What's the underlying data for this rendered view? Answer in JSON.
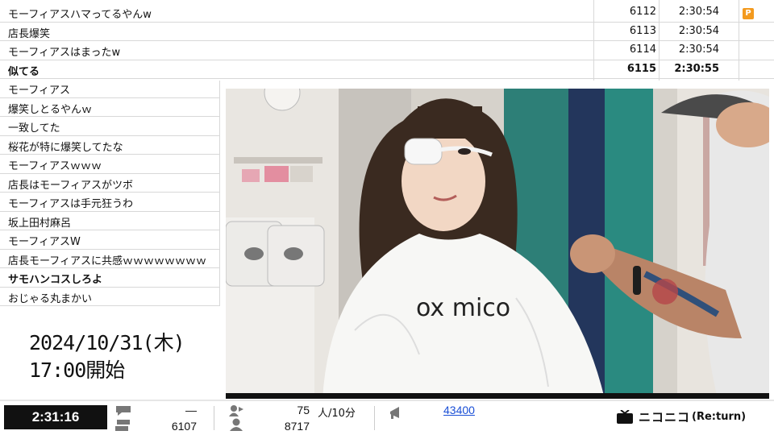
{
  "comments_top": [
    {
      "text": "モーフィアスハマってるやんw",
      "no": "6112",
      "time": "2:30:54",
      "badge": "P",
      "bold": false
    },
    {
      "text": "店長爆笑",
      "no": "6113",
      "time": "2:30:54",
      "badge": "",
      "bold": false
    },
    {
      "text": "モーフィアスはまったw",
      "no": "6114",
      "time": "2:30:54",
      "badge": "",
      "bold": false
    },
    {
      "text": "似てる",
      "no": "6115",
      "time": "2:30:55",
      "badge": "",
      "bold": true
    }
  ],
  "comments_left": [
    {
      "text": "モーフィアス",
      "bold": false
    },
    {
      "text": "爆笑しとるやんｗ",
      "bold": false
    },
    {
      "text": "一致してた",
      "bold": false
    },
    {
      "text": "桜花が特に爆笑してたな",
      "bold": false
    },
    {
      "text": "モーフィアスｗｗｗ",
      "bold": false
    },
    {
      "text": "店長はモーフィアスがツボ",
      "bold": false
    },
    {
      "text": "モーフィアスは手元狂うわ",
      "bold": false
    },
    {
      "text": "坂上田村麻呂",
      "bold": false
    },
    {
      "text": "モーフィアスW",
      "bold": false
    },
    {
      "text": "店長モーフィアスに共感ｗｗｗｗｗｗｗｗ",
      "bold": false
    },
    {
      "text": "サモハンコスしろよ",
      "bold": true
    },
    {
      "text": "おじゃる丸まかい",
      "bold": false
    }
  ],
  "schedule": {
    "date": "2024/10/31(木)",
    "start": "17:00開始"
  },
  "video": {
    "cape_text": "ox mico"
  },
  "status_bar": {
    "elapsed": "2:31:16",
    "comment_rate": "—",
    "comments_total": "6107",
    "viewers_rate": "75",
    "viewers_rate_unit": "人/10分",
    "visitors_total": "8717",
    "ad_points": "43400",
    "brand": "ニコニコ",
    "brand_suffix": "(Re:turn)"
  },
  "colors": {
    "badge": "#f39a1e",
    "link": "#1a4fd6"
  }
}
